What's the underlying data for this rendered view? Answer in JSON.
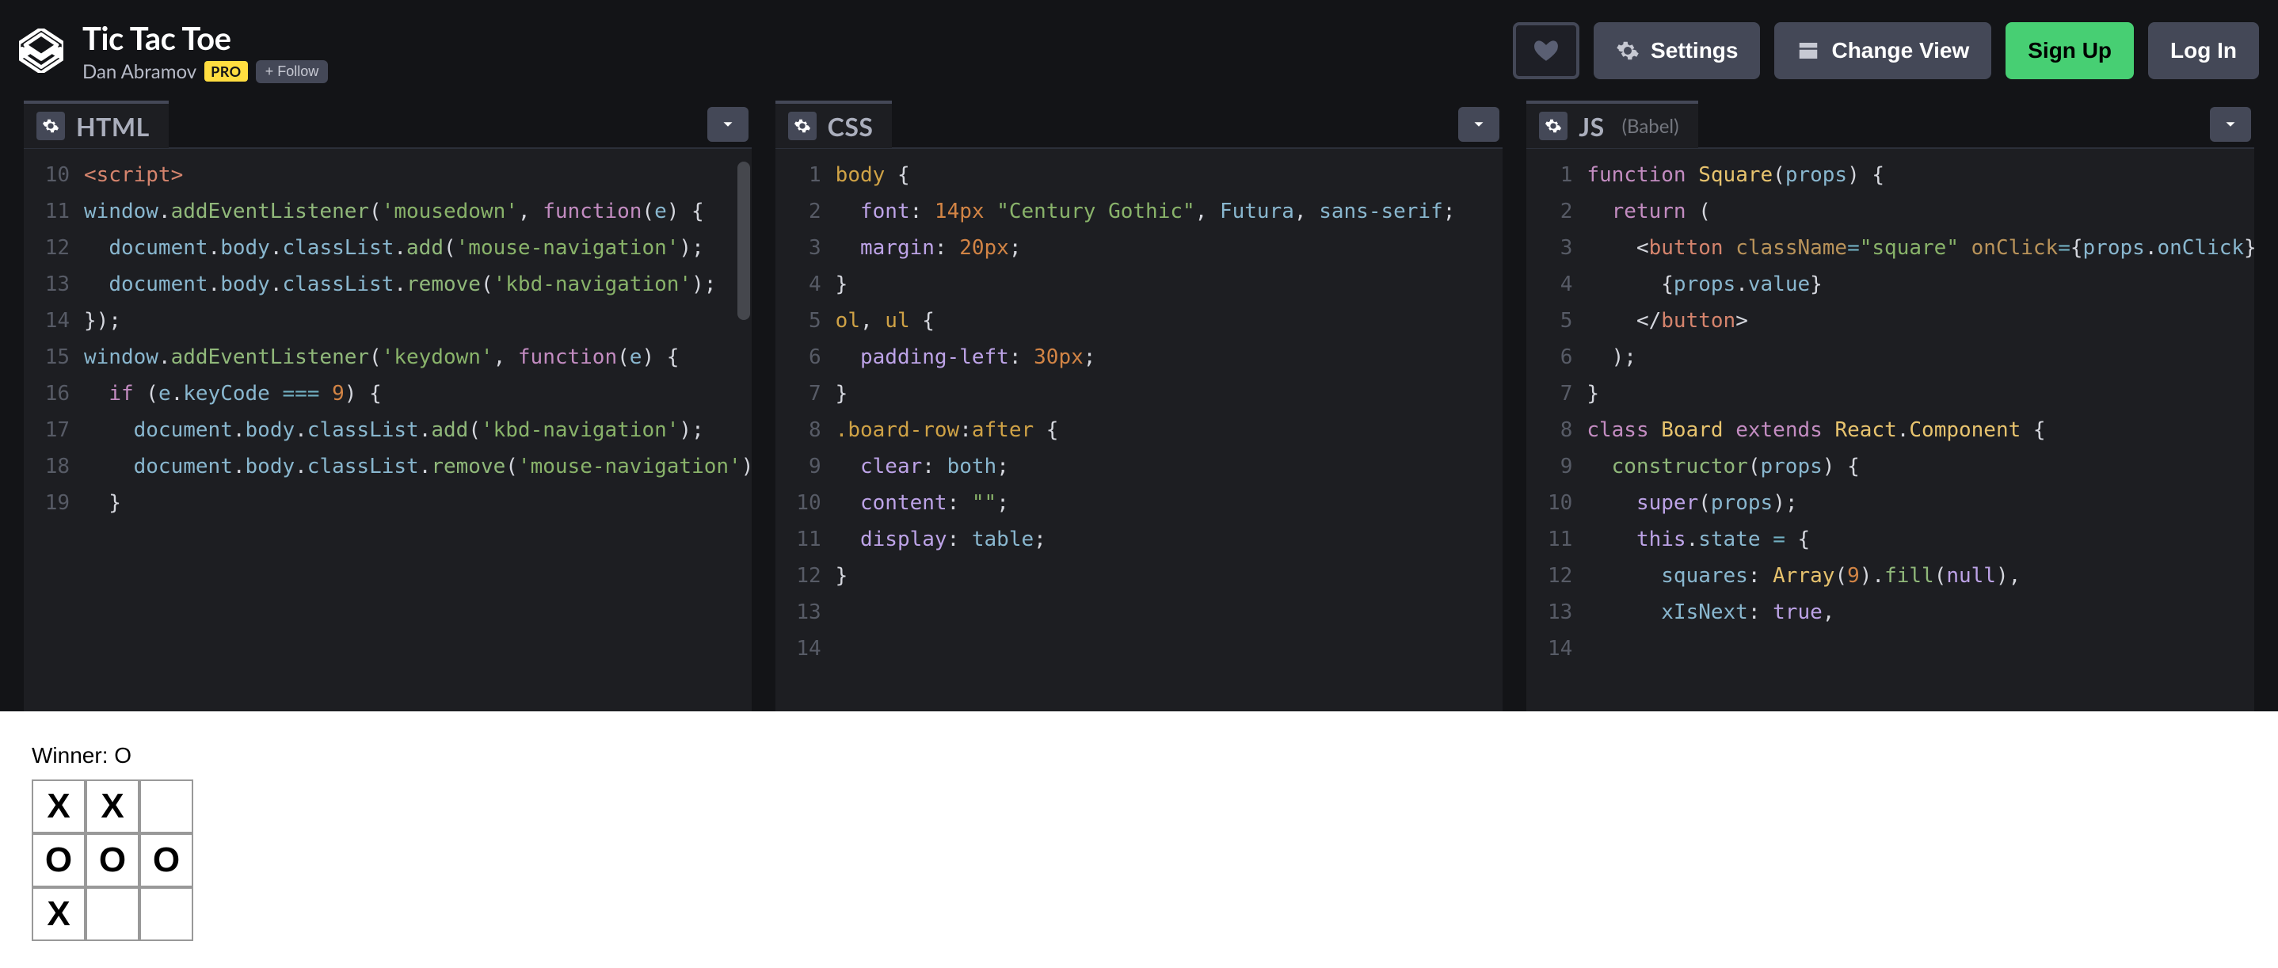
{
  "header": {
    "title": "Tic Tac Toe",
    "author": "Dan Abramov",
    "pro_badge": "PRO",
    "follow_label": "+ Follow",
    "settings_label": "Settings",
    "change_view_label": "Change View",
    "signup_label": "Sign Up",
    "login_label": "Log In"
  },
  "panels": {
    "html": {
      "title": "HTML",
      "first_line_no": 10,
      "gutter": [
        "10",
        "11",
        "12",
        "13",
        "14",
        "15",
        "16",
        "17",
        "18",
        "19"
      ]
    },
    "css": {
      "title": "CSS",
      "gutter": [
        "1",
        "2",
        "3",
        "4",
        "5",
        "6",
        "7",
        "8",
        "9",
        "10",
        "11",
        "12",
        "13",
        "14"
      ]
    },
    "js": {
      "title": "JS",
      "subtitle": "(Babel)",
      "gutter": [
        "1",
        "2",
        "3",
        "4",
        "5",
        "6",
        "7",
        "8",
        "9",
        "10",
        "11",
        "12",
        "13",
        "14"
      ]
    }
  },
  "code": {
    "html_lines": [
      [
        [
          "tag",
          "<script>"
        ]
      ],
      [
        [
          "ident",
          "window"
        ],
        [
          "punct",
          "."
        ],
        [
          "method",
          "addEventListener"
        ],
        [
          "punct",
          "("
        ],
        [
          "str",
          "'mousedown'"
        ],
        [
          "punct",
          ", "
        ],
        [
          "kw",
          "function"
        ],
        [
          "punct",
          "("
        ],
        [
          "ident",
          "e"
        ],
        [
          "punct",
          ") {"
        ]
      ],
      [
        [
          "default",
          "  "
        ],
        [
          "ident",
          "document"
        ],
        [
          "punct",
          "."
        ],
        [
          "ident",
          "body"
        ],
        [
          "punct",
          "."
        ],
        [
          "ident",
          "classList"
        ],
        [
          "punct",
          "."
        ],
        [
          "method",
          "add"
        ],
        [
          "punct",
          "("
        ],
        [
          "str",
          "'mouse-navigation'"
        ],
        [
          "punct",
          ");"
        ]
      ],
      [
        [
          "default",
          "  "
        ],
        [
          "ident",
          "document"
        ],
        [
          "punct",
          "."
        ],
        [
          "ident",
          "body"
        ],
        [
          "punct",
          "."
        ],
        [
          "ident",
          "classList"
        ],
        [
          "punct",
          "."
        ],
        [
          "method",
          "remove"
        ],
        [
          "punct",
          "("
        ],
        [
          "str",
          "'kbd-navigation'"
        ],
        [
          "punct",
          ");"
        ]
      ],
      [
        [
          "punct",
          "});"
        ]
      ],
      [
        [
          "ident",
          "window"
        ],
        [
          "punct",
          "."
        ],
        [
          "method",
          "addEventListener"
        ],
        [
          "punct",
          "("
        ],
        [
          "str",
          "'keydown'"
        ],
        [
          "punct",
          ", "
        ],
        [
          "kw",
          "function"
        ],
        [
          "punct",
          "("
        ],
        [
          "ident",
          "e"
        ],
        [
          "punct",
          ") {"
        ]
      ],
      [
        [
          "default",
          "  "
        ],
        [
          "kw",
          "if"
        ],
        [
          "punct",
          " ("
        ],
        [
          "ident",
          "e"
        ],
        [
          "punct",
          "."
        ],
        [
          "ident",
          "keyCode"
        ],
        [
          "punct",
          " "
        ],
        [
          "op",
          "==="
        ],
        [
          "punct",
          " "
        ],
        [
          "num",
          "9"
        ],
        [
          "punct",
          ") {"
        ]
      ],
      [
        [
          "default",
          "    "
        ],
        [
          "ident",
          "document"
        ],
        [
          "punct",
          "."
        ],
        [
          "ident",
          "body"
        ],
        [
          "punct",
          "."
        ],
        [
          "ident",
          "classList"
        ],
        [
          "punct",
          "."
        ],
        [
          "method",
          "add"
        ],
        [
          "punct",
          "("
        ],
        [
          "str",
          "'kbd-navigation'"
        ],
        [
          "punct",
          ");"
        ]
      ],
      [
        [
          "default",
          "    "
        ],
        [
          "ident",
          "document"
        ],
        [
          "punct",
          "."
        ],
        [
          "ident",
          "body"
        ],
        [
          "punct",
          "."
        ],
        [
          "ident",
          "classList"
        ],
        [
          "punct",
          "."
        ],
        [
          "method",
          "remove"
        ],
        [
          "punct",
          "("
        ],
        [
          "str",
          "'mouse-navigation'"
        ],
        [
          "punct",
          ");"
        ]
      ],
      [
        [
          "default",
          "  }"
        ]
      ]
    ],
    "css_lines": [
      [
        [
          "sel",
          "body"
        ],
        [
          "punct",
          " {"
        ]
      ],
      [
        [
          "default",
          "  "
        ],
        [
          "prop",
          "font"
        ],
        [
          "punct",
          ": "
        ],
        [
          "num",
          "14px"
        ],
        [
          "punct",
          " "
        ],
        [
          "str",
          "\"Century Gothic\""
        ],
        [
          "punct",
          ", "
        ],
        [
          "ident",
          "Futura"
        ],
        [
          "punct",
          ", "
        ],
        [
          "ident",
          "sans-serif"
        ],
        [
          "punct",
          ";"
        ]
      ],
      [
        [
          "default",
          "  "
        ],
        [
          "prop",
          "margin"
        ],
        [
          "punct",
          ": "
        ],
        [
          "num",
          "20px"
        ],
        [
          "punct",
          ";"
        ]
      ],
      [
        [
          "punct",
          "}"
        ]
      ],
      [
        [
          "default",
          ""
        ]
      ],
      [
        [
          "sel",
          "ol"
        ],
        [
          "punct",
          ", "
        ],
        [
          "sel",
          "ul"
        ],
        [
          "punct",
          " {"
        ]
      ],
      [
        [
          "default",
          "  "
        ],
        [
          "prop",
          "padding-left"
        ],
        [
          "punct",
          ": "
        ],
        [
          "num",
          "30px"
        ],
        [
          "punct",
          ";"
        ]
      ],
      [
        [
          "punct",
          "}"
        ]
      ],
      [
        [
          "default",
          ""
        ]
      ],
      [
        [
          "sel",
          ".board-row"
        ],
        [
          "punct",
          ":"
        ],
        [
          "sel",
          "after"
        ],
        [
          "punct",
          " {"
        ]
      ],
      [
        [
          "default",
          "  "
        ],
        [
          "prop",
          "clear"
        ],
        [
          "punct",
          ": "
        ],
        [
          "ident",
          "both"
        ],
        [
          "punct",
          ";"
        ]
      ],
      [
        [
          "default",
          "  "
        ],
        [
          "prop",
          "content"
        ],
        [
          "punct",
          ": "
        ],
        [
          "str",
          "\"\""
        ],
        [
          "punct",
          ";"
        ]
      ],
      [
        [
          "default",
          "  "
        ],
        [
          "prop",
          "display"
        ],
        [
          "punct",
          ": "
        ],
        [
          "ident",
          "table"
        ],
        [
          "punct",
          ";"
        ]
      ],
      [
        [
          "punct",
          "}"
        ]
      ]
    ],
    "js_lines": [
      [
        [
          "kw",
          "function"
        ],
        [
          "punct",
          " "
        ],
        [
          "class",
          "Square"
        ],
        [
          "punct",
          "("
        ],
        [
          "ident",
          "props"
        ],
        [
          "punct",
          ") {"
        ]
      ],
      [
        [
          "default",
          "  "
        ],
        [
          "kw",
          "return"
        ],
        [
          "punct",
          " ("
        ]
      ],
      [
        [
          "default",
          "    "
        ],
        [
          "punct",
          "<"
        ],
        [
          "tag",
          "button"
        ],
        [
          "punct",
          " "
        ],
        [
          "attr",
          "className"
        ],
        [
          "op",
          "="
        ],
        [
          "str",
          "\"square\""
        ],
        [
          "punct",
          " "
        ],
        [
          "attr",
          "onClick"
        ],
        [
          "op",
          "="
        ],
        [
          "punct",
          "{"
        ],
        [
          "ident",
          "props"
        ],
        [
          "punct",
          "."
        ],
        [
          "ident",
          "onClick"
        ],
        [
          "punct",
          "}>"
        ]
      ],
      [
        [
          "default",
          "      "
        ],
        [
          "punct",
          "{"
        ],
        [
          "ident",
          "props"
        ],
        [
          "punct",
          "."
        ],
        [
          "ident",
          "value"
        ],
        [
          "punct",
          "}"
        ]
      ],
      [
        [
          "default",
          "    "
        ],
        [
          "punct",
          "</"
        ],
        [
          "tag",
          "button"
        ],
        [
          "punct",
          ">"
        ]
      ],
      [
        [
          "default",
          "  "
        ],
        [
          "punct",
          ");"
        ]
      ],
      [
        [
          "punct",
          "}"
        ]
      ],
      [
        [
          "default",
          ""
        ]
      ],
      [
        [
          "kw",
          "class"
        ],
        [
          "punct",
          " "
        ],
        [
          "class",
          "Board"
        ],
        [
          "punct",
          " "
        ],
        [
          "kw",
          "extends"
        ],
        [
          "punct",
          " "
        ],
        [
          "class",
          "React"
        ],
        [
          "punct",
          "."
        ],
        [
          "class",
          "Component"
        ],
        [
          "punct",
          " {"
        ]
      ],
      [
        [
          "default",
          "  "
        ],
        [
          "method",
          "constructor"
        ],
        [
          "punct",
          "("
        ],
        [
          "ident",
          "props"
        ],
        [
          "punct",
          ") {"
        ]
      ],
      [
        [
          "default",
          "    "
        ],
        [
          "kw2",
          "super"
        ],
        [
          "punct",
          "("
        ],
        [
          "ident",
          "props"
        ],
        [
          "punct",
          ");"
        ]
      ],
      [
        [
          "default",
          "    "
        ],
        [
          "kw2",
          "this"
        ],
        [
          "punct",
          "."
        ],
        [
          "ident",
          "state"
        ],
        [
          "punct",
          " "
        ],
        [
          "op",
          "="
        ],
        [
          "punct",
          " {"
        ]
      ],
      [
        [
          "default",
          "      "
        ],
        [
          "ident",
          "squares"
        ],
        [
          "punct",
          ": "
        ],
        [
          "class",
          "Array"
        ],
        [
          "punct",
          "("
        ],
        [
          "num",
          "9"
        ],
        [
          "punct",
          ")."
        ],
        [
          "method",
          "fill"
        ],
        [
          "punct",
          "("
        ],
        [
          "kw2",
          "null"
        ],
        [
          "punct",
          "),"
        ]
      ],
      [
        [
          "default",
          "      "
        ],
        [
          "ident",
          "xIsNext"
        ],
        [
          "punct",
          ": "
        ],
        [
          "kw2",
          "true"
        ],
        [
          "punct",
          ","
        ]
      ]
    ]
  },
  "output": {
    "status": "Winner: O",
    "board": [
      "X",
      "X",
      "",
      "O",
      "O",
      "O",
      "X",
      "",
      ""
    ]
  }
}
